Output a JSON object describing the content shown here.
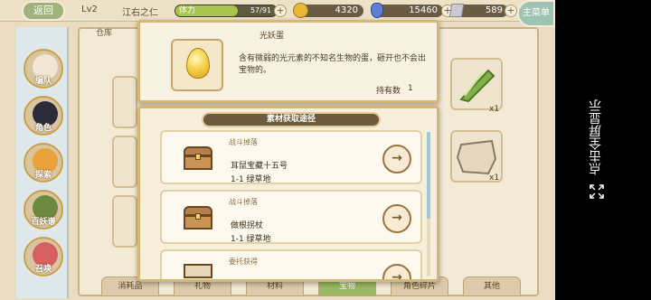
{
  "topbar": {
    "back_label": "返回",
    "level": "Lv2",
    "player_name": "江右之仁",
    "stamina_label": "体力",
    "stamina_value": "57/91",
    "stamina_fraction": 0.62,
    "gold": "4320",
    "gems": "15460",
    "tickets": "589",
    "menu_label": "主菜单"
  },
  "sidebar": {
    "items": [
      {
        "label": "编队",
        "icon": "character-avatar-icon",
        "color": "#f0e6d2"
      },
      {
        "label": "角色",
        "icon": "character-avatar-icon",
        "color": "#2b2b3a"
      },
      {
        "label": "探索",
        "icon": "character-avatar-icon",
        "color": "#e9a33a"
      },
      {
        "label": "百妖谱",
        "icon": "character-avatar-icon",
        "color": "#6c8a3f"
      },
      {
        "label": "召唤",
        "icon": "character-avatar-icon",
        "color": "#d66060"
      }
    ]
  },
  "warehouse": {
    "title": "仓库",
    "qty_1": "x1",
    "qty_2": "x1",
    "tabs": [
      "消耗品",
      "礼物",
      "材料",
      "宝物",
      "角色碎片",
      "其他"
    ],
    "active_tab": 3
  },
  "item": {
    "name": "光妖蛋",
    "description": "含有微弱的光元素的不知名生物的蛋，砸开也不会出宝物的。",
    "hold_label": "持有数",
    "hold_count": "1"
  },
  "sources": {
    "header": "素材获取途径",
    "cards": [
      {
        "type": "战斗掉落",
        "title": "耳鼠宝藏十五号",
        "stage": "1-1  绿草地"
      },
      {
        "type": "战斗掉落",
        "title": "做根拐杖",
        "stage": "1-1  绿草地"
      },
      {
        "type": "委托获得",
        "title": "",
        "stage": ""
      }
    ]
  },
  "overlay": {
    "fullscreen_text": "点击全屏显示"
  }
}
